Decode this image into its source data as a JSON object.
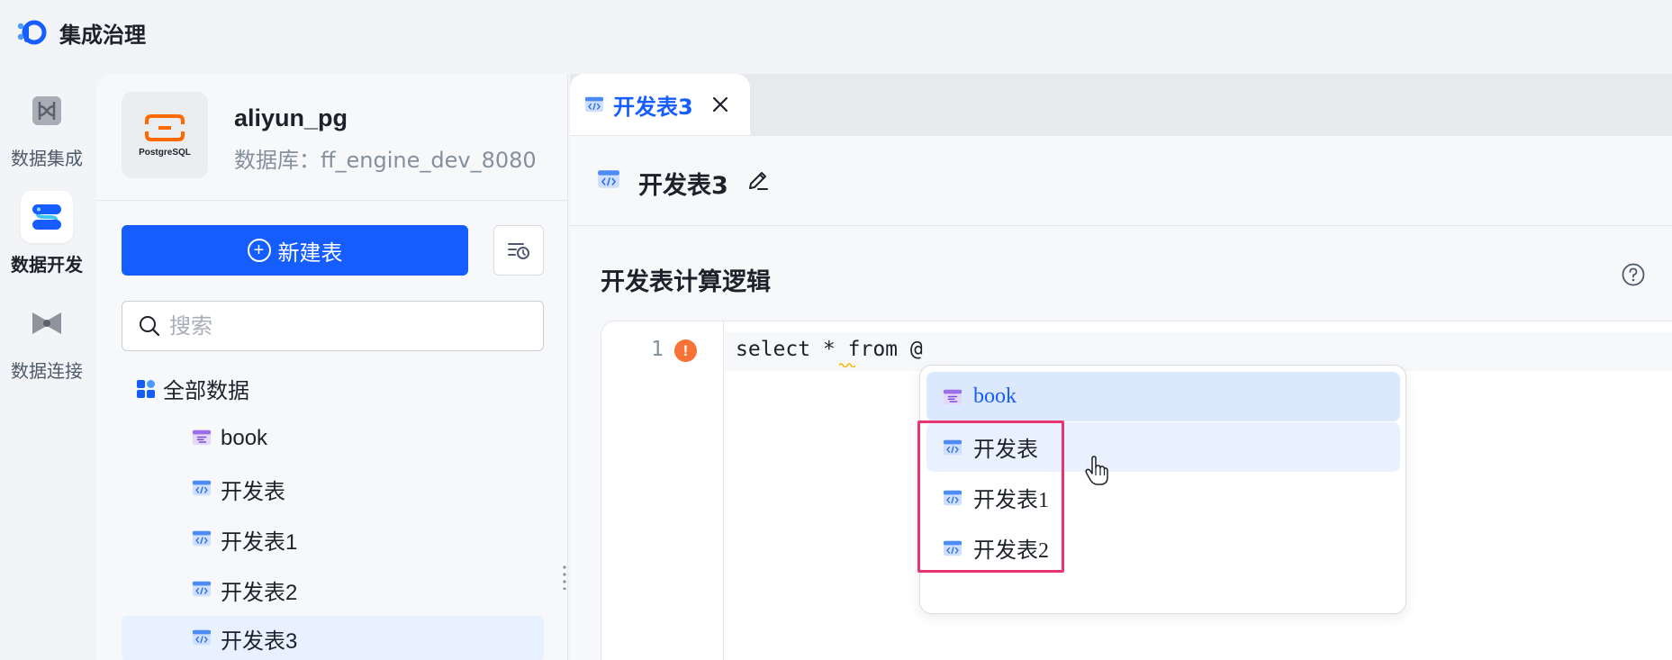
{
  "app": {
    "title": "集成治理"
  },
  "rail": {
    "items": [
      {
        "label": "数据集成",
        "icon": "data-integration-icon",
        "active": false
      },
      {
        "label": "数据开发",
        "icon": "data-development-icon",
        "active": true
      },
      {
        "label": "数据连接",
        "icon": "data-connection-icon",
        "active": false
      }
    ]
  },
  "sidebar": {
    "source": {
      "logo_text": "PostgreSQL",
      "name": "aliyun_pg",
      "database": "数据库：ff_engine_dev_8080"
    },
    "new_table_label": "新建表",
    "search_placeholder": "搜索",
    "tree_root": "全部数据",
    "tree_items": [
      {
        "label": "book",
        "icon": "table-icon"
      },
      {
        "label": "开发表",
        "icon": "dev-table-icon"
      },
      {
        "label": "开发表1",
        "icon": "dev-table-icon"
      },
      {
        "label": "开发表2",
        "icon": "dev-table-icon"
      },
      {
        "label": "开发表3",
        "icon": "dev-table-icon",
        "selected": true
      }
    ]
  },
  "main": {
    "tab_label": "开发表3",
    "page_title": "开发表3",
    "section_title": "开发表计算逻辑",
    "editor": {
      "line_number": "1",
      "warning_glyph": "!",
      "code": "select * from @"
    },
    "suggestions": [
      {
        "label": "book",
        "icon": "table-icon",
        "state": "active"
      },
      {
        "label": "开发表",
        "icon": "dev-table-icon",
        "state": "hover"
      },
      {
        "label": "开发表1",
        "icon": "dev-table-icon",
        "state": ""
      },
      {
        "label": "开发表2",
        "icon": "dev-table-icon",
        "state": ""
      }
    ]
  },
  "colors": {
    "primary": "#165dff",
    "warning": "#f77234",
    "highlight": "#e8356d",
    "postgres_orange": "#ff6a00"
  }
}
